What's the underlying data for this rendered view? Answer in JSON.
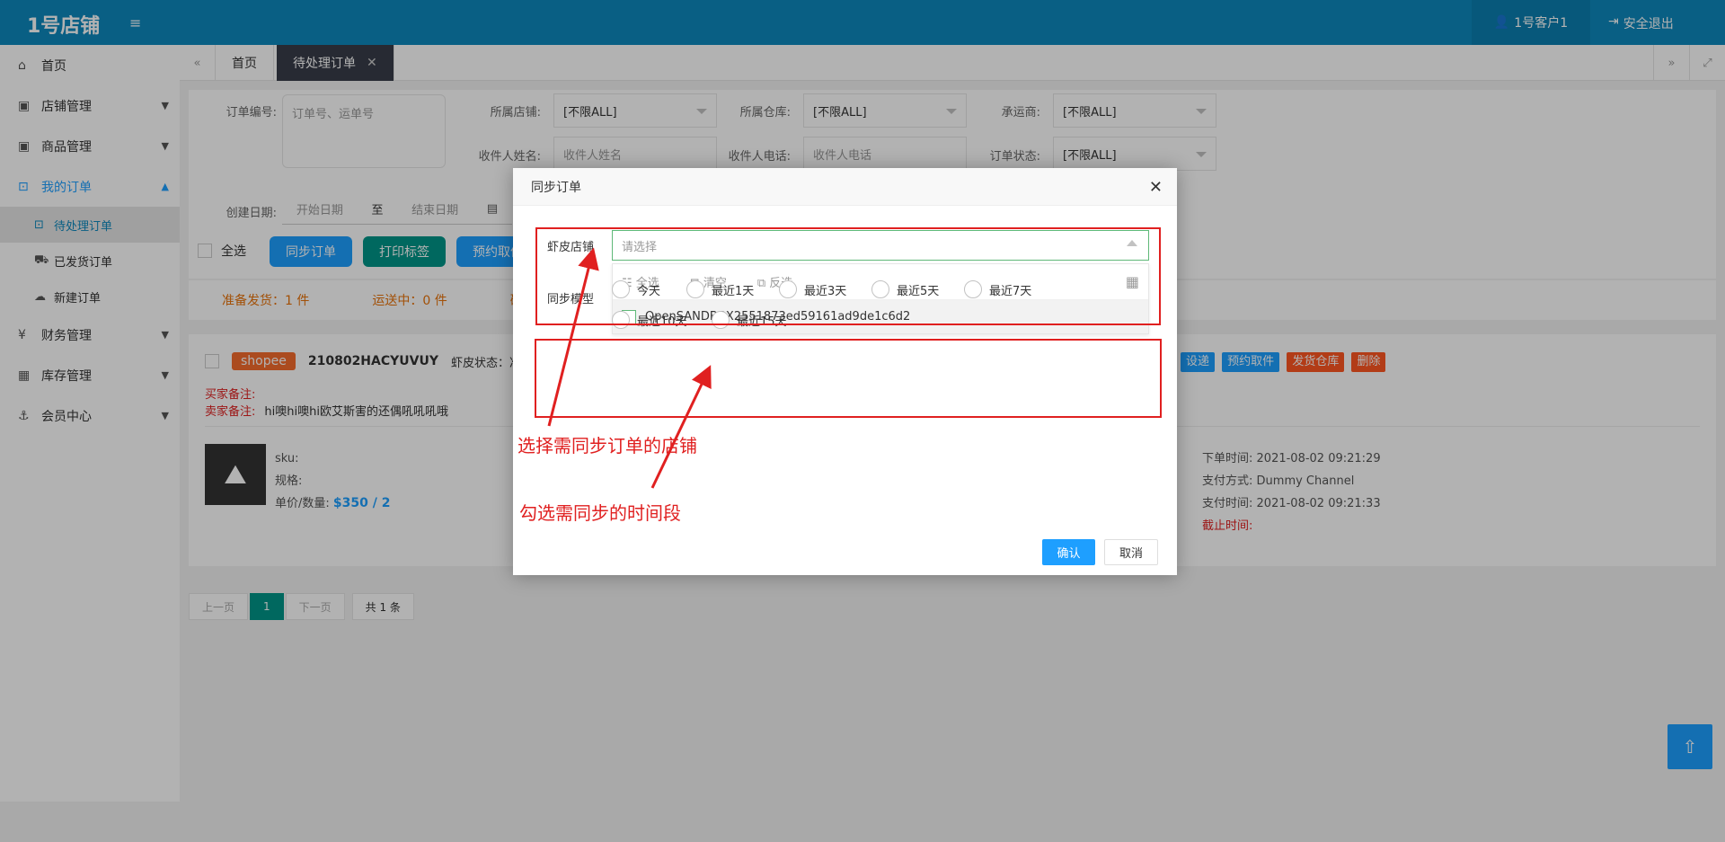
{
  "topbar": {
    "logo": "1号店铺",
    "user": "1号客户1",
    "logout": "安全退出"
  },
  "sidebar": {
    "items": [
      {
        "label": "首页"
      },
      {
        "label": "店铺管理"
      },
      {
        "label": "商品管理"
      },
      {
        "label": "我的订单"
      },
      {
        "label": "财务管理"
      },
      {
        "label": "库存管理"
      },
      {
        "label": "会员中心"
      }
    ],
    "subitems": [
      {
        "label": "待处理订单"
      },
      {
        "label": "已发货订单"
      },
      {
        "label": "新建订单"
      }
    ]
  },
  "tabs": [
    {
      "label": "首页"
    },
    {
      "label": "待处理订单"
    }
  ],
  "filters": {
    "order_no_label": "订单编号:",
    "order_no_placeholder": "订单号、运单号",
    "shop_label": "所属店铺:",
    "shop_value": "[不限ALL]",
    "warehouse_label": "所属仓库:",
    "warehouse_value": "[不限ALL]",
    "carrier_label": "承运商:",
    "carrier_value": "[不限ALL]",
    "receiver_name_label": "收件人姓名:",
    "receiver_name_placeholder": "收件人姓名",
    "receiver_phone_label": "收件人电话:",
    "receiver_phone_placeholder": "收件人电话",
    "status_label": "订单状态:",
    "status_value": "[不限ALL]",
    "date_label": "创建日期:",
    "date_start": "开始日期",
    "date_to": "至",
    "date_end": "结束日期"
  },
  "actions": {
    "select_all": "全选",
    "sync": "同步订单",
    "print": "打印标签",
    "schedule": "预约取件"
  },
  "summary": {
    "ready": "准备发货：1 件",
    "transit": "运送中：0 件",
    "third": "确"
  },
  "order": {
    "platform": "shopee",
    "order_no": "210802HACYUVUY",
    "status_label": "虾皮状态：准",
    "buyer_note_label": "买家备注:",
    "seller_note_label": "卖家备注:",
    "seller_note": "hi噢hi噢hi欧艾斯害的还偶吼吼吼哦",
    "sku_label": "sku:",
    "spec_label": "规格:",
    "price_label": "单价/数量:",
    "price": "$350 / 2",
    "order_time_label": "下单时间:",
    "order_time": "2021-08-02 09:21:29",
    "pay_method_label": "支付方式:",
    "pay_method": "Dummy Channel",
    "pay_time_label": "支付时间:",
    "pay_time": "2021-08-02 09:21:33",
    "deadline_label": "截止时间:",
    "btn_delivery": "设递",
    "btn_pickup": "预约取件",
    "btn_warehouse": "发货仓库",
    "btn_delete": "删除"
  },
  "pager": {
    "prev": "上一页",
    "page": "1",
    "next": "下一页",
    "total": "共 1 条"
  },
  "dialog": {
    "title": "同步订单",
    "shop_label": "虾皮店铺",
    "shop_placeholder": "请选择",
    "model_label": "同步模型",
    "dd_all": "全选",
    "dd_clear": "清空",
    "dd_invert": "反选",
    "dd_option": "OpenSANDBOX2551873ed59161ad9de1c6d2",
    "ranges": [
      "今天",
      "最近1天",
      "最近3天",
      "最近5天",
      "最近7天",
      "最近10天",
      "最近15天"
    ],
    "confirm": "确认",
    "cancel": "取消"
  },
  "annotations": {
    "shop": "选择需同步订单的店铺",
    "range": "勾选需同步的时间段"
  },
  "colors": {
    "topbar": "#0d88bd",
    "blue": "#1e9fff",
    "green": "#009688",
    "red": "#e02020",
    "orange": "#ff5722"
  }
}
